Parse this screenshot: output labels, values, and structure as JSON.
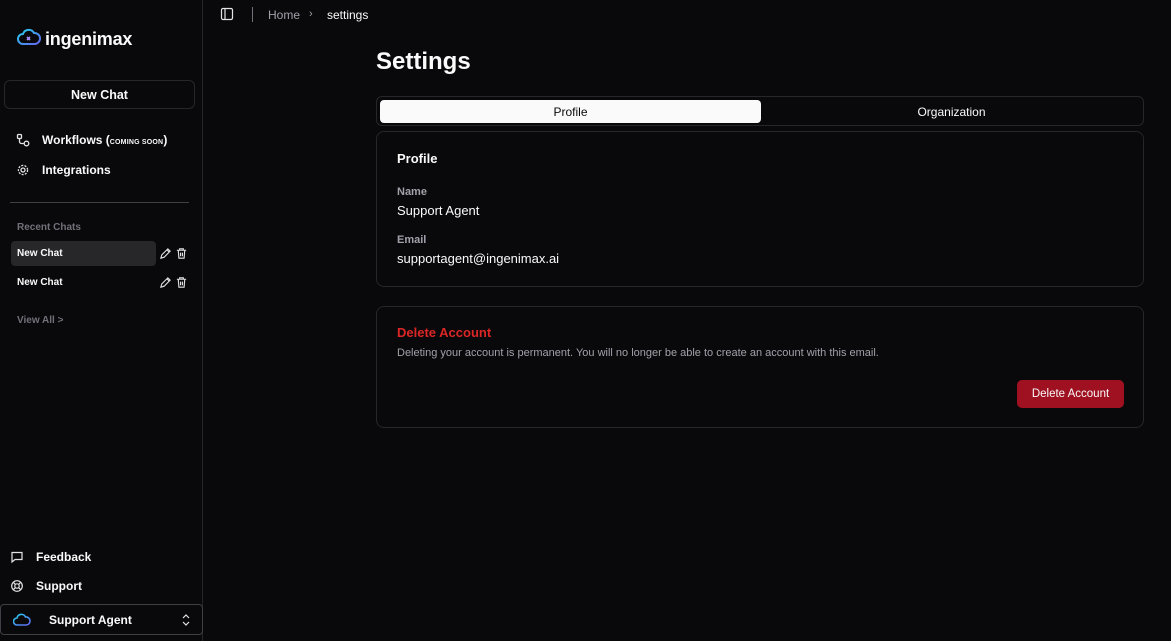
{
  "app": {
    "brand": "ingenimax"
  },
  "sidebar": {
    "new_chat_label": "New Chat",
    "nav": [
      {
        "label": "Workflows (",
        "suffix": "COMING SOON",
        "close": ")",
        "icon": "workflow-icon"
      },
      {
        "label": "Integrations",
        "icon": "gear-icon"
      }
    ],
    "recent_label": "Recent Chats",
    "recent_chats": [
      {
        "label": "New Chat"
      },
      {
        "label": "New Chat"
      }
    ],
    "view_all": "View All >",
    "bottom": [
      {
        "label": "Feedback",
        "icon": "message-square-icon"
      },
      {
        "label": "Support",
        "icon": "life-buoy-icon"
      }
    ],
    "user": {
      "name": "Support Agent"
    }
  },
  "breadcrumb": {
    "home": "Home",
    "separator": "›",
    "current": "settings"
  },
  "page": {
    "title": "Settings",
    "tabs": [
      {
        "label": "Profile"
      },
      {
        "label": "Organization"
      }
    ],
    "profile": {
      "title": "Profile",
      "name_label": "Name",
      "name_value": "Support Agent",
      "email_label": "Email",
      "email_value": "supportagent@ingenimax.ai"
    },
    "danger": {
      "title": "Delete Account",
      "description": "Deleting your account is permanent. You will no longer be able to create an account with this email.",
      "button_label": "Delete Account"
    }
  },
  "colors": {
    "background": "#09090b",
    "border": "#27272a",
    "danger_text": "#dc2626",
    "danger_button": "#9f1020",
    "muted_text": "#a1a1aa"
  }
}
